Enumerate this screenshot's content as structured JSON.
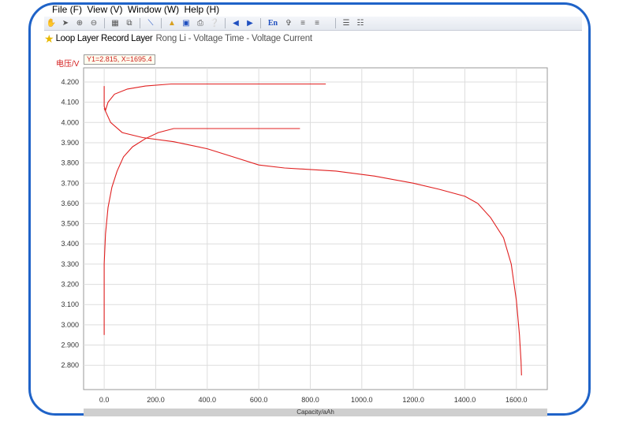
{
  "menu": {
    "items": [
      "File (F)",
      "View (V)",
      "Window (W)",
      "Help (H)"
    ]
  },
  "toolbar": {
    "lang_label": "En",
    "icons": [
      "hand-icon",
      "pointer-icon",
      "zoom-in-icon",
      "zoom-out-icon",
      "table-icon",
      "copy-icon",
      "line-icon",
      "open-folder-icon",
      "save-icon",
      "print-icon",
      "help-icon",
      "back-arrow-icon",
      "forward-arrow-icon",
      "language-icon",
      "pin-icon",
      "list-up-icon",
      "list-down-icon",
      "grid-view-icon",
      "tree-view-icon"
    ]
  },
  "layer": {
    "record_label": "Loop Layer Record Layer",
    "subtitle": "Rong Li - Voltage Time - Voltage Current"
  },
  "readout": "Y1=2.815, X=1695.4",
  "chart_data": {
    "type": "line",
    "ylabel": "电压/V",
    "xlabel": "Capacity/aAh",
    "xlim": [
      -80,
      1720
    ],
    "ylim": [
      2.68,
      4.27
    ],
    "x_ticks": [
      "0.0",
      "200.0",
      "400.0",
      "600.0",
      "800.0",
      "1000.0",
      "1200.0",
      "1400.0",
      "1600.0"
    ],
    "x_tick_values": [
      0,
      200,
      400,
      600,
      800,
      1000,
      1200,
      1400,
      1600
    ],
    "y_ticks": [
      "4.200",
      "4.100",
      "4.000",
      "3.900",
      "3.800",
      "3.700",
      "3.600",
      "3.500",
      "3.400",
      "3.300",
      "3.200",
      "3.100",
      "3.000",
      "2.900",
      "2.800"
    ],
    "y_tick_values": [
      4.2,
      4.1,
      4.0,
      3.9,
      3.8,
      3.7,
      3.6,
      3.5,
      3.4,
      3.3,
      3.2,
      3.1,
      3.0,
      2.9,
      2.8
    ],
    "grid": true,
    "series_color": "#e02020",
    "series": [
      {
        "values": [
          [
            0,
            2.95
          ],
          [
            0,
            3.3
          ],
          [
            5,
            3.45
          ],
          [
            15,
            3.58
          ],
          [
            30,
            3.68
          ],
          [
            50,
            3.76
          ],
          [
            75,
            3.83
          ],
          [
            110,
            3.88
          ],
          [
            160,
            3.92
          ],
          [
            210,
            3.95
          ],
          [
            270,
            3.97
          ],
          [
            760,
            3.97
          ]
        ]
      },
      {
        "values": [
          [
            0,
            4.18
          ],
          [
            0,
            4.08
          ],
          [
            5,
            4.06
          ],
          [
            15,
            4.1
          ],
          [
            40,
            4.14
          ],
          [
            90,
            4.165
          ],
          [
            160,
            4.18
          ],
          [
            260,
            4.19
          ],
          [
            860,
            4.19
          ]
        ]
      },
      {
        "values": [
          [
            0,
            4.07
          ],
          [
            25,
            4.0
          ],
          [
            70,
            3.95
          ],
          [
            150,
            3.925
          ],
          [
            270,
            3.905
          ],
          [
            400,
            3.87
          ],
          [
            500,
            3.83
          ],
          [
            600,
            3.79
          ],
          [
            700,
            3.775
          ],
          [
            900,
            3.76
          ],
          [
            1050,
            3.735
          ],
          [
            1200,
            3.7
          ],
          [
            1300,
            3.67
          ],
          [
            1400,
            3.635
          ],
          [
            1450,
            3.6
          ],
          [
            1500,
            3.53
          ],
          [
            1550,
            3.43
          ],
          [
            1580,
            3.3
          ],
          [
            1600,
            3.12
          ],
          [
            1612,
            2.95
          ],
          [
            1618,
            2.82
          ],
          [
            1620,
            2.75
          ]
        ]
      }
    ]
  }
}
